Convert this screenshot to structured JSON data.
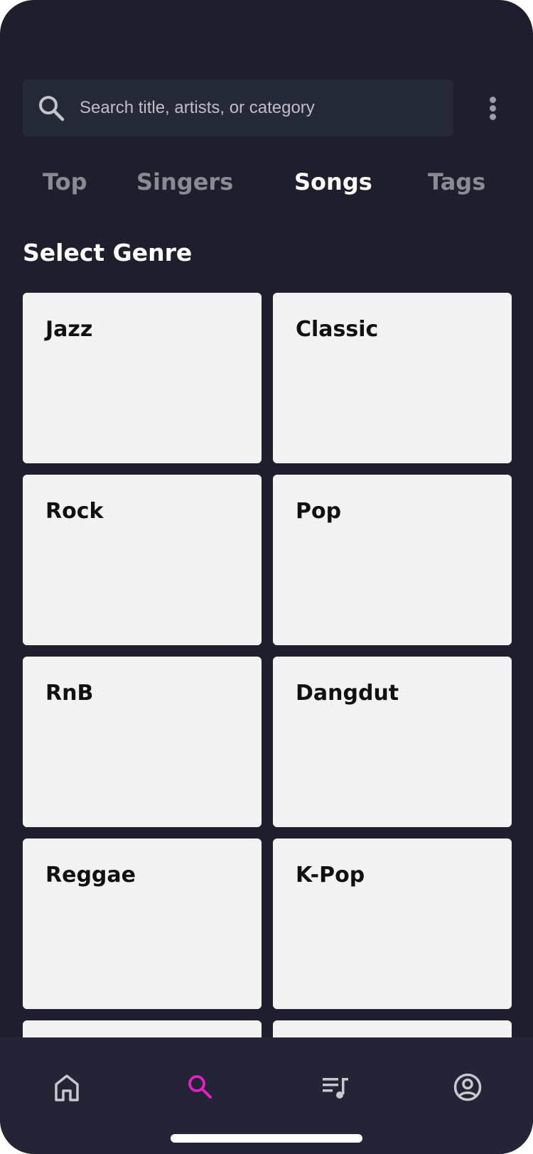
{
  "search": {
    "placeholder": "Search title, artists, or category",
    "icon": "search-icon"
  },
  "menu": {
    "icon": "more-vertical-icon"
  },
  "tabs": [
    {
      "label": "Top",
      "active": false
    },
    {
      "label": "Singers",
      "active": false
    },
    {
      "label": "Songs",
      "active": true
    },
    {
      "label": "Tags",
      "active": false
    }
  ],
  "section": {
    "title": "Select Genre"
  },
  "genres": [
    {
      "label": "Jazz"
    },
    {
      "label": "Classic"
    },
    {
      "label": "Rock"
    },
    {
      "label": "Pop"
    },
    {
      "label": "RnB"
    },
    {
      "label": "Dangdut"
    },
    {
      "label": "Reggae"
    },
    {
      "label": "K-Pop"
    }
  ],
  "bottom_nav": [
    {
      "icon": "home-icon",
      "active": false
    },
    {
      "icon": "search-icon",
      "active": true
    },
    {
      "icon": "playlist-icon",
      "active": false
    },
    {
      "icon": "profile-icon",
      "active": false
    }
  ],
  "colors": {
    "background": "#1f1e2d",
    "search_background": "#262a38",
    "card": "#f2f2f2",
    "accent": "#e81ec6",
    "tab_inactive": "#8a8a94",
    "tab_active": "#ffffff",
    "nav_background": "#232536",
    "nav_icon": "#c8c9cf"
  }
}
